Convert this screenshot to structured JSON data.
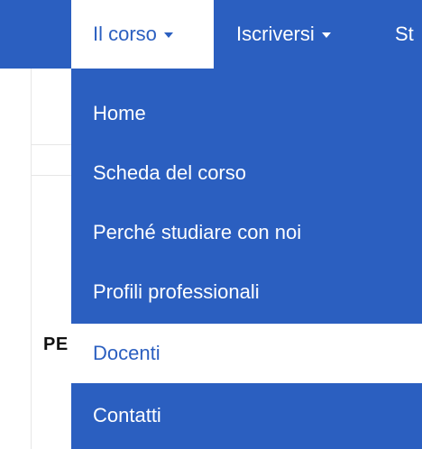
{
  "navbar": {
    "items": [
      {
        "label": "Il corso",
        "has_caret": true,
        "active": true
      },
      {
        "label": "Iscriversi",
        "has_caret": true,
        "active": false
      },
      {
        "label": "St",
        "has_caret": false,
        "active": false
      }
    ]
  },
  "page": {
    "partial_text": "PE"
  },
  "dropdown": {
    "items": [
      {
        "label": "Home"
      },
      {
        "label": "Scheda del corso"
      },
      {
        "label": "Perché studiare con noi"
      },
      {
        "label": "Profili professionali"
      },
      {
        "label": "Docenti",
        "highlighted": true
      },
      {
        "label": "Contatti"
      }
    ]
  },
  "colors": {
    "primary_blue": "#2b5fc0",
    "white": "#ffffff",
    "text_dark": "#111111"
  }
}
